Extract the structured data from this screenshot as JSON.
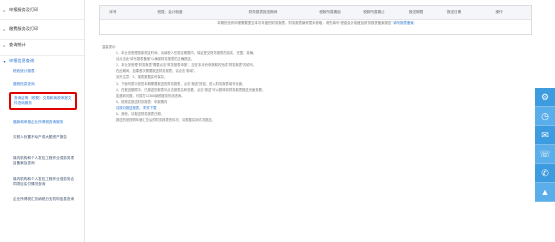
{
  "sidebar": {
    "groups": [
      {
        "label": "申报服务及打印",
        "open": false
      },
      {
        "label": "缴费服务及打印",
        "open": false
      },
      {
        "label": "查询统计",
        "open": false
      },
      {
        "label": "申报信息查询",
        "open": true
      }
    ],
    "items": [
      {
        "label": "税收统计报表"
      },
      {
        "label": "缴税信息查询"
      },
      {
        "label": "查询证明（税费）交易和纳税申报文件查询服务",
        "selected": true
      },
      {
        "label": "缴款和申报企业所得税查询服务"
      },
      {
        "label": "欠税人处置不动产或大额资产报告"
      },
      {
        "label": "境内机构和个人发包工程作业或劳务项目备案及查询"
      },
      {
        "label": "境内机构和个人发包工程作业或劳务合同项目实付情况查询"
      },
      {
        "label": "企业所得税汇总纳税分支机构信息查询"
      }
    ]
  },
  "table": {
    "columns": [
      "序号",
      "税费、会计制度",
      "财务报表报送期间",
      "税款所属期起",
      "税款所属期止",
      "报送期限",
      "报送日期",
      "操作"
    ],
    "empty_message": "本期的没有申报需要提交本次年度的财务报表，财务报表编号暂未获取，请先填写“税费会计制度及财务报表备案报告”",
    "empty_link": "填写报表备案"
  },
  "notes": {
    "heading": "温馨提示：",
    "lines": [
      "1、本业务受理按原规定时间，请纳税人在规定期限内，保证提交财务报表的真实、完整、准确。",
      "  请点击此“填写报表备案”以确保财务报表的正确报送。",
      "2、本业务受理“财务报表”需要点击“财务报表申报”，应在本月份申报期内完成“财务报表”的填写。",
      "  在此期间，如果首次需要报送财务报表，请点击“新增”。",
      "  另外注意：3、报表数据实时保存。",
      "3、下面列表中是您本期需要报送的财务报表，点击“报送”按钮，进入财务报表填写页面。",
      "4、在报送期限中，已报送的报表可点击报表名称查看，点击“报送”可以跳转到财务报表报送页面查看；",
      "  如遇到问题，可拨打12366纳税服务热线咨询。",
      "5、按规定报送财务报表：申报期内",
      "  请按月报送报表。 附件下载",
      "6、其他，请报送财务报表日期，",
      "  报送的是按照年度汇总后的财务报表的情况，请根据实际情况报送。"
    ]
  },
  "toolbar": {
    "icons": [
      "gear-icon",
      "clock-icon",
      "mail-icon",
      "chat-icon",
      "phone-icon",
      "top-icon"
    ]
  }
}
